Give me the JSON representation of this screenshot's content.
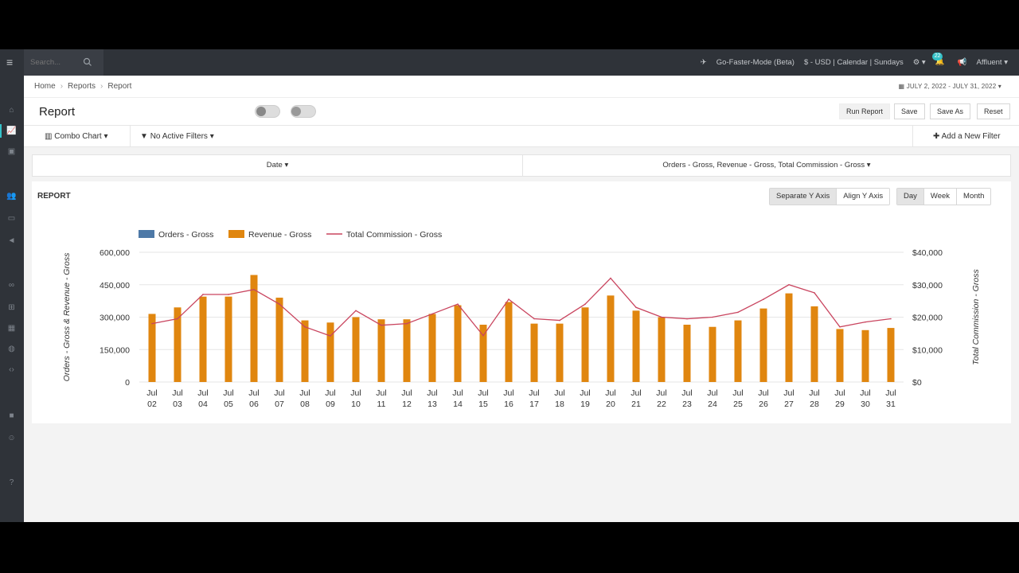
{
  "topbar": {
    "search_placeholder": "Search...",
    "mode": "Go-Faster-Mode (Beta)",
    "settings": "$ - USD | Calendar | Sundays",
    "notifications_count": "22",
    "user": "Affluent"
  },
  "breadcrumbs": {
    "home": "Home",
    "reports": "Reports",
    "current": "Report"
  },
  "date_range": "JULY 2, 2022 - JULY 31, 2022",
  "page_title": "Report",
  "actions": {
    "run": "Run Report",
    "save": "Save",
    "save_as": "Save As",
    "reset": "Reset"
  },
  "filters": {
    "chart_type": "Combo Chart",
    "active_filters": "No Active Filters",
    "add_filter": "Add a New Filter"
  },
  "dimensions": {
    "left": "Date",
    "right": "Orders - Gross, Revenue - Gross, Total Commission - Gross"
  },
  "panel": {
    "title": "REPORT",
    "axis_modes": [
      "Separate Y Axis",
      "Align Y Axis"
    ],
    "axis_selected": "Separate Y Axis",
    "periods": [
      "Day",
      "Week",
      "Month"
    ],
    "period_selected": "Day"
  },
  "colors": {
    "orders": "#4e79a7",
    "revenue": "#e0860f",
    "commission": "#c9455f"
  },
  "chart_data": {
    "type": "bar",
    "categories": [
      "Jul 02",
      "Jul 03",
      "Jul 04",
      "Jul 05",
      "Jul 06",
      "Jul 07",
      "Jul 08",
      "Jul 09",
      "Jul 10",
      "Jul 11",
      "Jul 12",
      "Jul 13",
      "Jul 14",
      "Jul 15",
      "Jul 16",
      "Jul 17",
      "Jul 18",
      "Jul 19",
      "Jul 20",
      "Jul 21",
      "Jul 22",
      "Jul 23",
      "Jul 24",
      "Jul 25",
      "Jul 26",
      "Jul 27",
      "Jul 28",
      "Jul 29",
      "Jul 30",
      "Jul 31"
    ],
    "series": [
      {
        "name": "Orders - Gross",
        "type": "bar",
        "axis": "left",
        "values": []
      },
      {
        "name": "Revenue - Gross",
        "type": "bar",
        "axis": "left",
        "values": [
          315000,
          345000,
          395000,
          395000,
          495000,
          390000,
          285000,
          275000,
          300000,
          290000,
          290000,
          315000,
          355000,
          265000,
          370000,
          270000,
          270000,
          345000,
          400000,
          330000,
          300000,
          265000,
          255000,
          285000,
          340000,
          410000,
          350000,
          245000,
          240000,
          250000
        ]
      },
      {
        "name": "Total Commission - Gross",
        "type": "line",
        "axis": "right",
        "values": [
          18000,
          19500,
          27000,
          27000,
          28500,
          24000,
          17000,
          14200,
          22000,
          17500,
          18000,
          21000,
          24000,
          14300,
          25500,
          19500,
          19000,
          24000,
          32000,
          23000,
          20000,
          19500,
          20000,
          21500,
          25500,
          30000,
          27500,
          17000,
          18500,
          19500
        ]
      }
    ],
    "y_left": {
      "label": "Orders - Gross & Revenue - Gross",
      "ticks": [
        "0",
        "150,000",
        "300,000",
        "450,000",
        "600,000"
      ],
      "lim": [
        0,
        600000
      ]
    },
    "y_right": {
      "label": "Total Commission - Gross",
      "ticks": [
        "$0",
        "$10,000",
        "$20,000",
        "$30,000",
        "$40,000"
      ],
      "lim": [
        0,
        40000
      ]
    },
    "legend": [
      "Orders - Gross",
      "Revenue - Gross",
      "Total Commission - Gross"
    ],
    "legend_position": "top-left",
    "grid": true
  }
}
